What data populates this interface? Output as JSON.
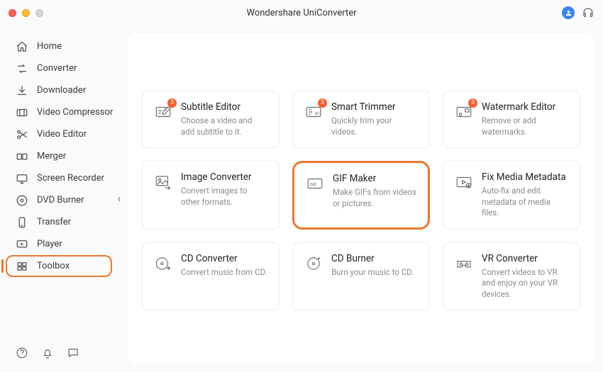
{
  "app_title": "Wondershare UniConverter",
  "sidebar": {
    "items": [
      {
        "label": "Home"
      },
      {
        "label": "Converter"
      },
      {
        "label": "Downloader"
      },
      {
        "label": "Video Compressor"
      },
      {
        "label": "Video Editor"
      },
      {
        "label": "Merger"
      },
      {
        "label": "Screen Recorder"
      },
      {
        "label": "DVD Burner"
      },
      {
        "label": "Transfer"
      },
      {
        "label": "Player"
      },
      {
        "label": "Toolbox"
      }
    ]
  },
  "tools": [
    {
      "title": "Subtitle Editor",
      "desc": "Choose a video and add subtitle to it.",
      "hot": true
    },
    {
      "title": "Smart Trimmer",
      "desc": "Quickly trim your videos.",
      "hot": true
    },
    {
      "title": "Watermark Editor",
      "desc": "Remove or add watermarks.",
      "hot": true
    },
    {
      "title": "Image Converter",
      "desc": "Convert images to other formats."
    },
    {
      "title": "GIF Maker",
      "desc": "Make GIFs from videos or pictures.",
      "selected": true
    },
    {
      "title": "Fix Media Metadata",
      "desc": "Auto-fix and edit metadata of media files."
    },
    {
      "title": "CD Converter",
      "desc": "Convert music from CD."
    },
    {
      "title": "CD Burner",
      "desc": "Burn your music to CD."
    },
    {
      "title": "VR Converter",
      "desc": "Convert videos to VR and enjoy on your VR devices."
    }
  ]
}
